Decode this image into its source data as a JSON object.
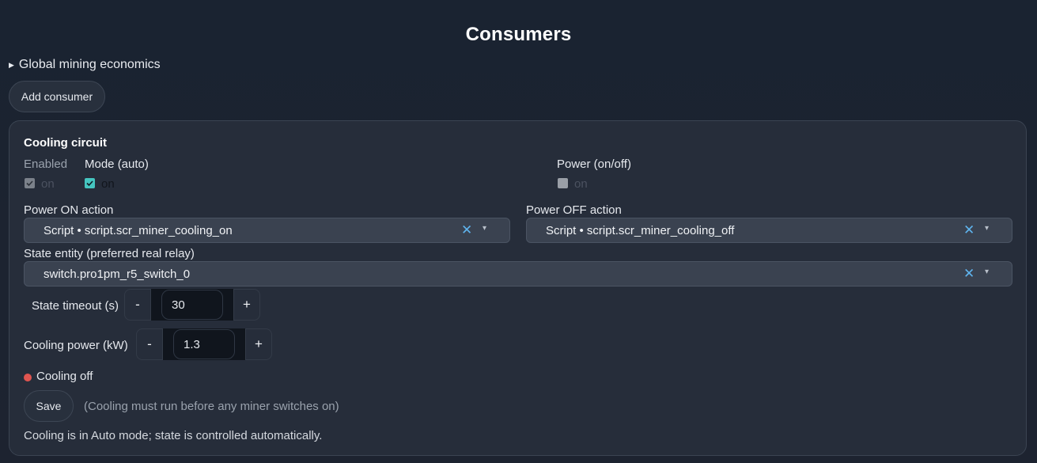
{
  "page": {
    "title": "Consumers"
  },
  "economics": {
    "summary": "Global mining economics"
  },
  "actions": {
    "add_consumer": "Add consumer"
  },
  "consumer": {
    "name": "Cooling circuit",
    "enabled": {
      "label": "Enabled",
      "option": "on",
      "checked": true,
      "disabled": true
    },
    "mode": {
      "label": "Mode (auto)",
      "option": "on",
      "checked": true
    },
    "power": {
      "label": "Power (on/off)",
      "option": "on",
      "checked": false,
      "disabled": true
    },
    "power_on_action": {
      "label": "Power ON action",
      "value": "Script • script.scr_miner_cooling_on"
    },
    "power_off_action": {
      "label": "Power OFF action",
      "value": "Script • script.scr_miner_cooling_off"
    },
    "state_entity": {
      "label": "State entity (preferred real relay)",
      "value": "switch.pro1pm_r5_switch_0"
    },
    "state_timeout": {
      "label": "State timeout (s)",
      "value": "30",
      "minus": "-",
      "plus": "+"
    },
    "cooling_power": {
      "label": "Cooling power (kW)",
      "value": "1.3",
      "minus": "-",
      "plus": "+"
    },
    "status": {
      "text": "Cooling off",
      "color": "#e05550"
    },
    "save": "Save",
    "save_hint": "(Cooling must run before any miner switches on)",
    "footer_note": "Cooling is in Auto mode; state is controlled automatically."
  },
  "colors": {
    "accent": "#45c5c0",
    "clear_icon": "#5fb4ee",
    "background": "#1c2330",
    "card": "#262d3a"
  },
  "icons": {
    "summary_toggle": "triangle-right-icon",
    "clear": "close-icon",
    "dropdown": "chevron-down-icon",
    "status": "status-dot-icon"
  }
}
